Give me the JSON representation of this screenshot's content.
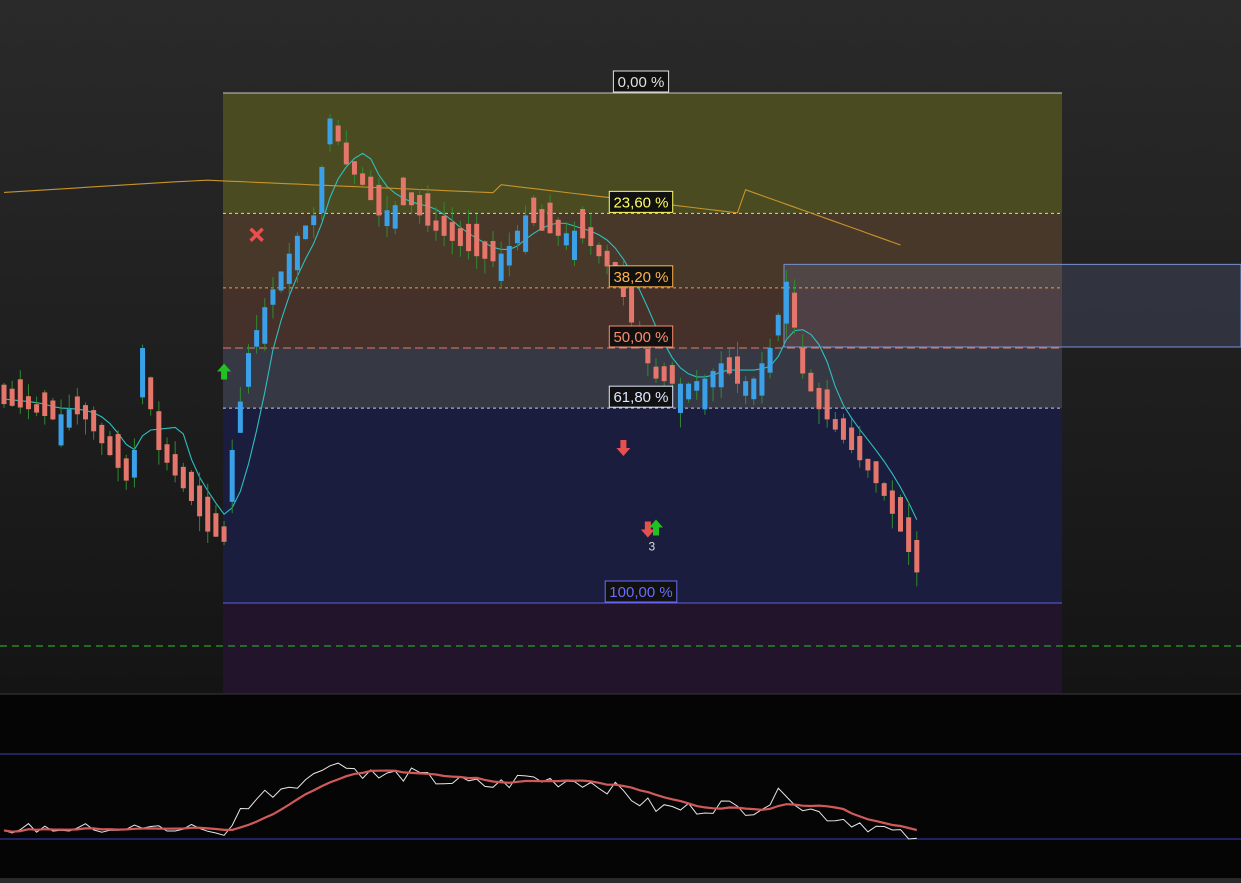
{
  "chart_data": [
    {
      "type": "candlestick",
      "title": "",
      "xlabel": "",
      "ylabel": "",
      "x": {
        "start_index": 0,
        "end_index": 112
      },
      "ylim": [
        0,
        100
      ],
      "note_scale": "y expressed on the Fibonacci retracement scale shown by the labels (0 = top of retracement range, 100 = bottom); price axis values are not printed",
      "candles": [
        [
          62,
          62.5,
          60,
          59.6,
          61.5,
          61.5
        ],
        [
          58.5,
          62,
          63,
          57,
          64,
          63
        ],
        [
          60,
          63,
          64.5,
          62.5,
          65,
          64.5
        ],
        [
          61.5,
          62.5,
          61.5,
          61.5,
          61,
          59
        ],
        [
          63,
          64,
          65,
          63.5,
          66.5,
          65.5
        ],
        [
          67.5,
          70,
          74,
          71.5,
          71,
          70
        ],
        [
          70.5,
          72.5,
          73.5,
          70,
          72.5,
          75
        ],
        [
          73.5,
          69.5,
          67.8,
          72,
          71,
          69
        ],
        [
          70,
          70.5,
          70.8,
          70.5,
          73,
          75
        ],
        [
          68.5,
          71,
          72.5,
          70.5,
          74,
          76
        ],
        [
          78.5,
          81,
          84,
          78,
          81,
          83
        ],
        [
          86.5,
          85.5,
          84,
          88.5,
          89,
          87
        ],
        [
          85.5,
          88,
          90.5,
          88.5,
          90,
          93
        ]
      ],
      "ma_fast": [],
      "ma_slow": [],
      "fibonacci": {
        "levels": [
          {
            "label": "0,00 %",
            "value": 0,
            "color": "#e0e0e0"
          },
          {
            "label": "23,60 %",
            "value": 23.6,
            "color": "#ffff66"
          },
          {
            "label": "38,20 %",
            "value": 38.2,
            "color": "#ffb347"
          },
          {
            "label": "50,00 %",
            "value": 50,
            "color": "#ff8c6a"
          },
          {
            "label": "61,80 %",
            "value": 61.8,
            "color": "#dfe8ff"
          },
          {
            "label": "100,00 %",
            "value": 100,
            "color": "#6b6bff"
          }
        ],
        "zone_colors": [
          "#4b4b22",
          "#48382a",
          "#46302a",
          "#363944",
          "#1b1d3e",
          "#22142a"
        ]
      },
      "support_line": {
        "value": 108.5,
        "style": "dashed",
        "color": "#2ec02e"
      },
      "resistance_box": {
        "from_value": 33.6,
        "to_value": 49.8,
        "start_index": 76,
        "color": "#7a8fd0"
      },
      "signals": [
        {
          "type": "buy-arrow",
          "index": 27,
          "value": 54.6
        },
        {
          "type": "cross",
          "index": 31,
          "value": 27.8
        },
        {
          "type": "sell-arrow",
          "index": 76,
          "value": 69.6
        },
        {
          "type": "sell-arrow",
          "index": 79,
          "value": 85.6
        },
        {
          "type": "buy-arrow",
          "index": 80,
          "value": 85.2
        }
      ],
      "signal_count_label": "3",
      "colors": {
        "up": "#3aa0e8",
        "down": "#e5766b",
        "wick": "#2f8a2f",
        "ma_fast": "#2bc0c0",
        "ma_slow": "#c89428"
      }
    },
    {
      "type": "line",
      "title": "",
      "xlabel": "",
      "ylabel": "",
      "ylim": [
        0,
        100
      ],
      "bands": [
        80,
        0
      ],
      "series": [
        {
          "values": [],
          "color": "#e6e6e6"
        },
        {
          "values": [],
          "color": "#d05a5a"
        }
      ]
    }
  ]
}
